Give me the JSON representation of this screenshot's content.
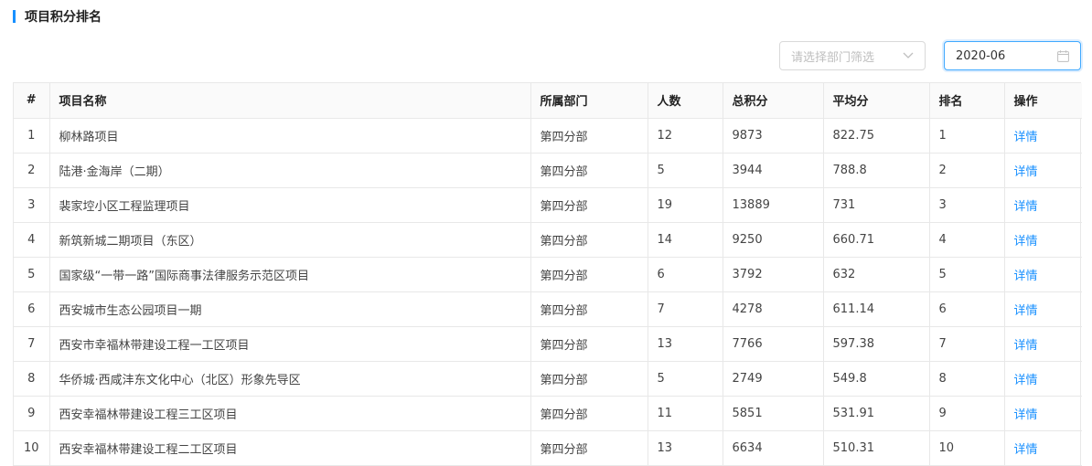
{
  "title": "项目积分排名",
  "filters": {
    "department_placeholder": "请选择部门筛选",
    "month_value": "2020-06"
  },
  "table": {
    "headers": [
      "#",
      "项目名称",
      "所属部门",
      "人数",
      "总积分",
      "平均分",
      "排名",
      "操作"
    ],
    "rows": [
      {
        "index": "1",
        "name": "柳林路项目",
        "dept": "第四分部",
        "people": "12",
        "total": "9873",
        "avg": "822.75",
        "rank": "1",
        "action": "详情"
      },
      {
        "index": "2",
        "name": "陆港·金海岸（二期）",
        "dept": "第四分部",
        "people": "5",
        "total": "3944",
        "avg": "788.8",
        "rank": "2",
        "action": "详情"
      },
      {
        "index": "3",
        "name": "裴家埪小区工程监理项目",
        "dept": "第四分部",
        "people": "19",
        "total": "13889",
        "avg": "731",
        "rank": "3",
        "action": "详情"
      },
      {
        "index": "4",
        "name": "新筑新城二期项目（东区）",
        "dept": "第四分部",
        "people": "14",
        "total": "9250",
        "avg": "660.71",
        "rank": "4",
        "action": "详情"
      },
      {
        "index": "5",
        "name": "国家级“一带一路”国际商事法律服务示范区项目",
        "dept": "第四分部",
        "people": "6",
        "total": "3792",
        "avg": "632",
        "rank": "5",
        "action": "详情"
      },
      {
        "index": "6",
        "name": "西安城市生态公园项目一期",
        "dept": "第四分部",
        "people": "7",
        "total": "4278",
        "avg": "611.14",
        "rank": "6",
        "action": "详情"
      },
      {
        "index": "7",
        "name": "西安市幸福林带建设工程一工区项目",
        "dept": "第四分部",
        "people": "13",
        "total": "7766",
        "avg": "597.38",
        "rank": "7",
        "action": "详情"
      },
      {
        "index": "8",
        "name": "华侨城·西咸沣东文化中心（北区）形象先导区",
        "dept": "第四分部",
        "people": "5",
        "total": "2749",
        "avg": "549.8",
        "rank": "8",
        "action": "详情"
      },
      {
        "index": "9",
        "name": "西安幸福林带建设工程三工区项目",
        "dept": "第四分部",
        "people": "11",
        "total": "5851",
        "avg": "531.91",
        "rank": "9",
        "action": "详情"
      },
      {
        "index": "10",
        "name": "西安幸福林带建设工程二工区项目",
        "dept": "第四分部",
        "people": "13",
        "total": "6634",
        "avg": "510.31",
        "rank": "10",
        "action": "详情"
      }
    ]
  },
  "colors": {
    "accent": "#1890ff",
    "link": "#1890ff",
    "header_bg": "#fafafa",
    "border": "#e8e8e8"
  }
}
